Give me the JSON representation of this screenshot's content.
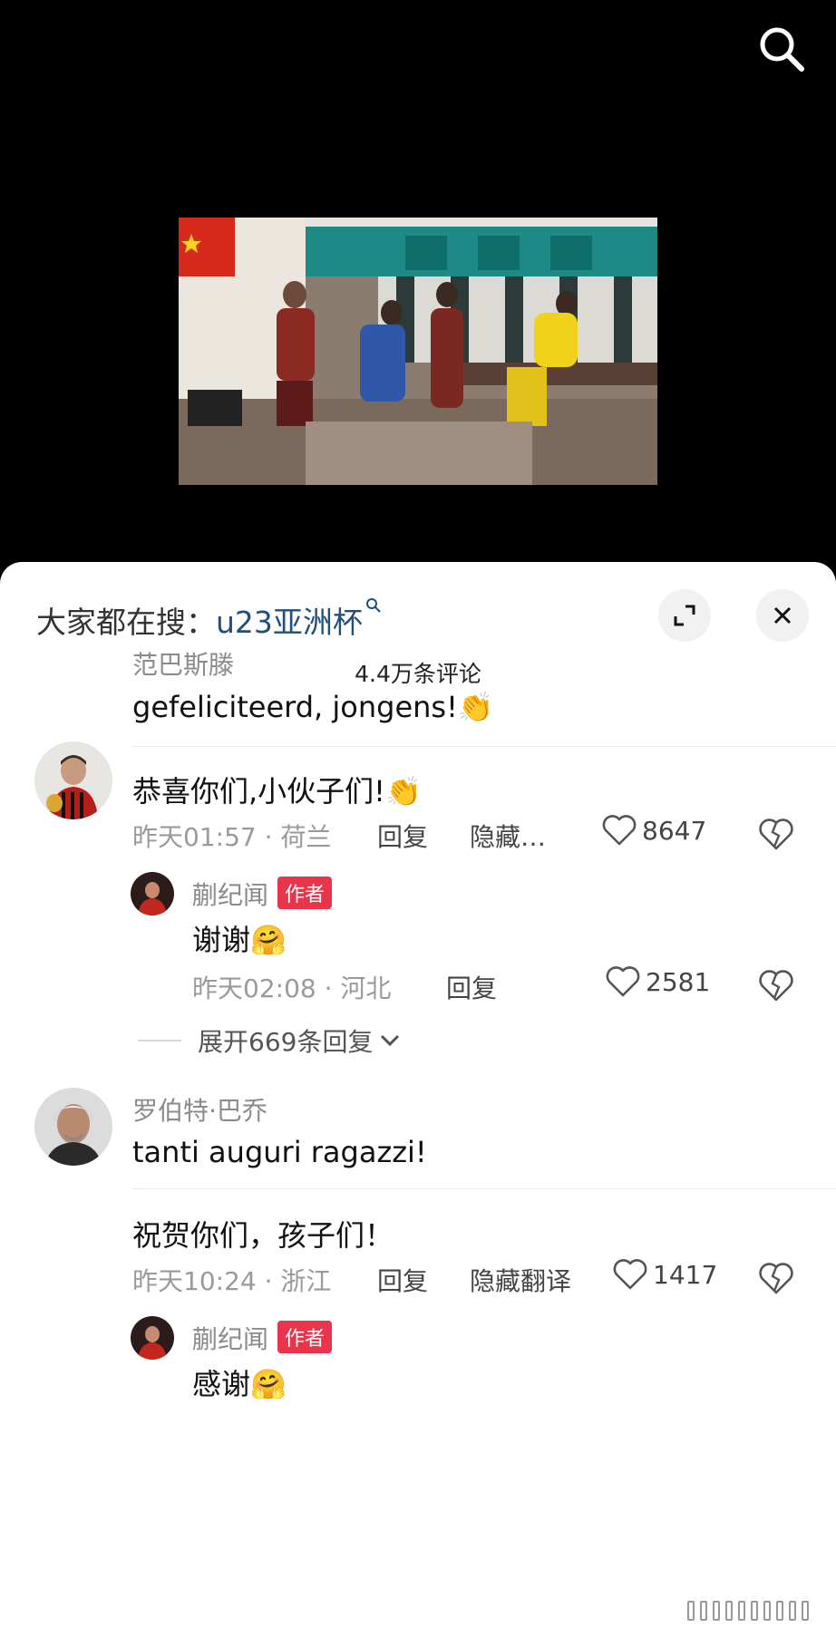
{
  "search_hint": {
    "prefix": "大家都在搜：",
    "term": "u23亚洲杯"
  },
  "comment_count": "4.4万条评论",
  "comments": [
    {
      "username": "范巴斯滕",
      "text": "gefeliciteerd, jongens!👏",
      "translation": "恭喜你们,小伙子们!👏",
      "time": "昨天01:57",
      "location": "荷兰",
      "reply_label": "回复",
      "hide_label": "隐藏…",
      "likes": "8647",
      "author_reply": {
        "username": "蒯纪闻",
        "badge": "作者",
        "text": "谢谢🤗",
        "time": "昨天02:08",
        "location": "河北",
        "reply_label": "回复",
        "likes": "2581"
      },
      "expand_label": "展开669条回复"
    },
    {
      "username": "罗伯特·巴乔",
      "text": "tanti auguri ragazzi!",
      "translation": "祝贺你们，孩子们！",
      "time": "昨天10:24",
      "location": "浙江",
      "reply_label": "回复",
      "hide_label": "隐藏翻译",
      "likes": "1417",
      "author_reply": {
        "username": "蒯纪闻",
        "badge": "作者",
        "text": "感谢🤗"
      }
    }
  ],
  "colors": {
    "accent_link": "#1e4f7f",
    "author_badge": "#e8354b"
  }
}
